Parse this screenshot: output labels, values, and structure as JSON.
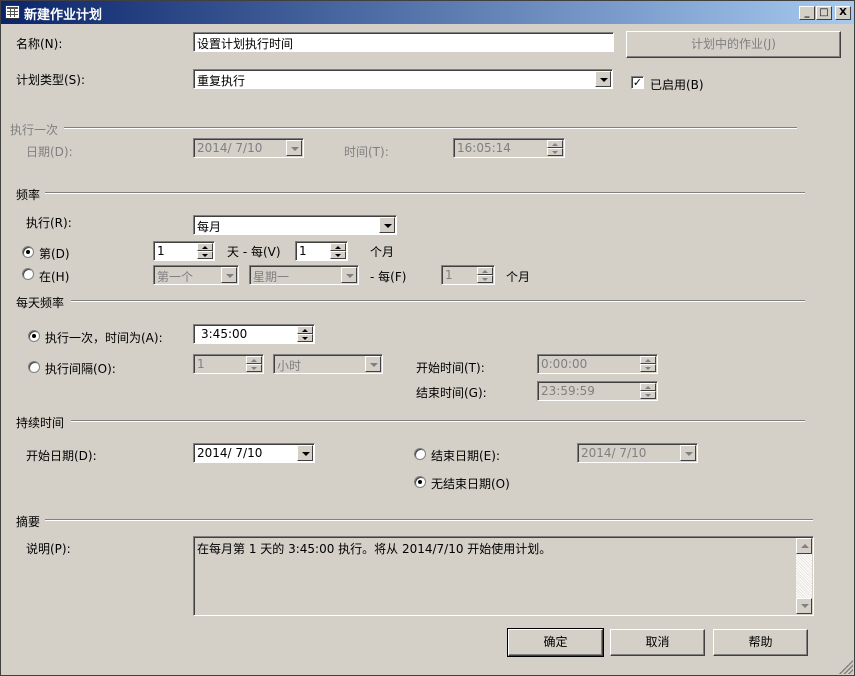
{
  "window": {
    "title": "新建作业计划",
    "minimize": "_",
    "maximize": "□",
    "close": "X"
  },
  "name": {
    "label": "名称(N):",
    "value": "设置计划执行时间"
  },
  "jobs_button": "计划中的作业(J)",
  "schedule_type": {
    "label": "计划类型(S):",
    "value": "重复执行"
  },
  "enabled": {
    "label": "已启用(B)",
    "checked": true,
    "mark": "✓"
  },
  "once": {
    "group": "执行一次",
    "date_label": "日期(D):",
    "date_value": "2014/ 7/10",
    "time_label": "时间(T):",
    "time_value": "16:05:14"
  },
  "frequency": {
    "group": "频率",
    "occurs_label": "执行(R):",
    "occurs_value": "每月",
    "day_radio": "第(D)",
    "day_value": "1",
    "day_text": "天 - 每(V)",
    "every_value": "1",
    "month_text": "个月",
    "on_radio": "在(H)",
    "on_first": "第一个",
    "on_weekday": "星期一",
    "on_every_text": "- 每(F)",
    "on_every_value": "1",
    "on_month_text": "个月"
  },
  "daily": {
    "group": "每天频率",
    "once_radio": "执行一次，时间为(A):",
    "once_time": "3:45:00",
    "every_radio": "执行间隔(O):",
    "every_value": "1",
    "every_unit": "小时",
    "start_label": "开始时间(T):",
    "start_value": "0:00:00",
    "end_label": "结束时间(G):",
    "end_value": "23:59:59"
  },
  "duration": {
    "group": "持续时间",
    "start_label": "开始日期(D):",
    "start_value": "2014/ 7/10",
    "end_radio": "结束日期(E):",
    "end_value": "2014/ 7/10",
    "no_end_radio": "无结束日期(O)"
  },
  "summary": {
    "group": "摘要",
    "desc_label": "说明(P):",
    "desc_value": "在每月第 1 天的 3:45:00 执行。将从 2014/7/10 开始使用计划。"
  },
  "buttons": {
    "ok": "确定",
    "cancel": "取消",
    "help": "帮助"
  }
}
